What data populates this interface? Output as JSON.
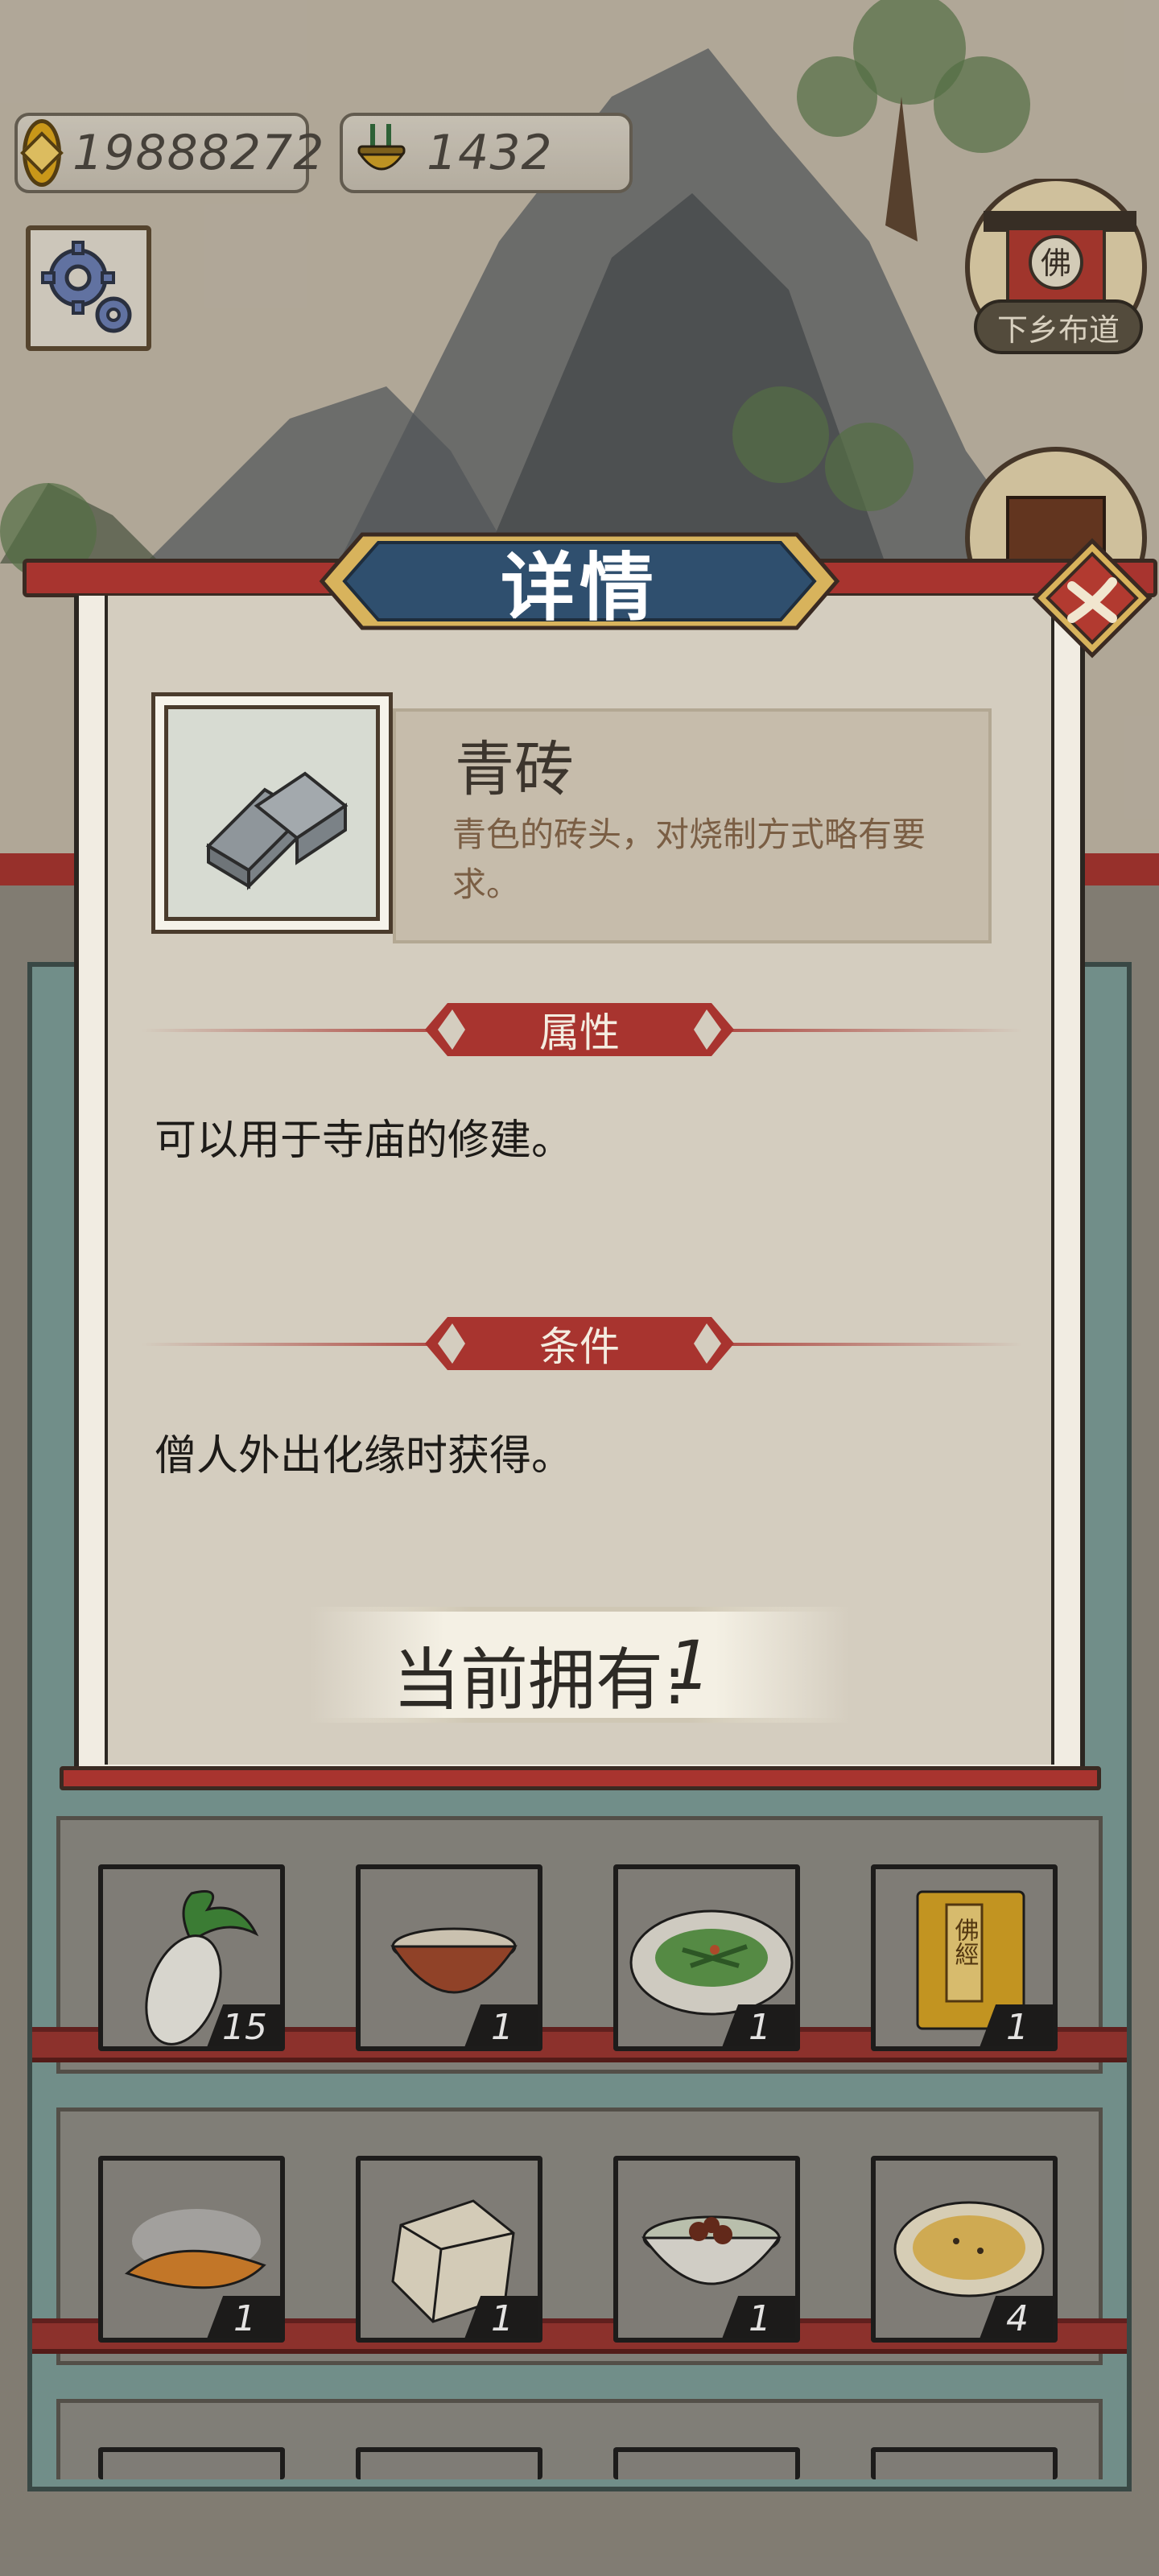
{
  "currency": {
    "coins": "19888272",
    "incense": "1432"
  },
  "side_buttons": {
    "village_preach_label": "下乡布道",
    "village_preach_badge": "佛"
  },
  "dialog": {
    "title": "详情",
    "item": {
      "name": "青砖",
      "description": "青色的砖头，对烧制方式略有要求。"
    },
    "attributes_header": "属性",
    "attributes_text": "可以用于寺庙的修建。",
    "conditions_header": "条件",
    "conditions_text": "僧人外出化缘时获得。",
    "owned_label": "当前拥有:",
    "owned_value": "1"
  },
  "inventory": {
    "rows": [
      [
        {
          "item": "white-radish",
          "count": "15"
        },
        {
          "item": "rice-bowl",
          "count": "1"
        },
        {
          "item": "green-vegetable-dish",
          "count": "1"
        },
        {
          "item": "buddhist-sutra-book",
          "count": "1",
          "book_text": "佛經"
        }
      ],
      [
        {
          "item": "roasted-sweet-potato",
          "count": "1"
        },
        {
          "item": "tofu",
          "count": "1"
        },
        {
          "item": "mushroom-soup",
          "count": "1"
        },
        {
          "item": "pancake",
          "count": "4"
        }
      ]
    ]
  }
}
